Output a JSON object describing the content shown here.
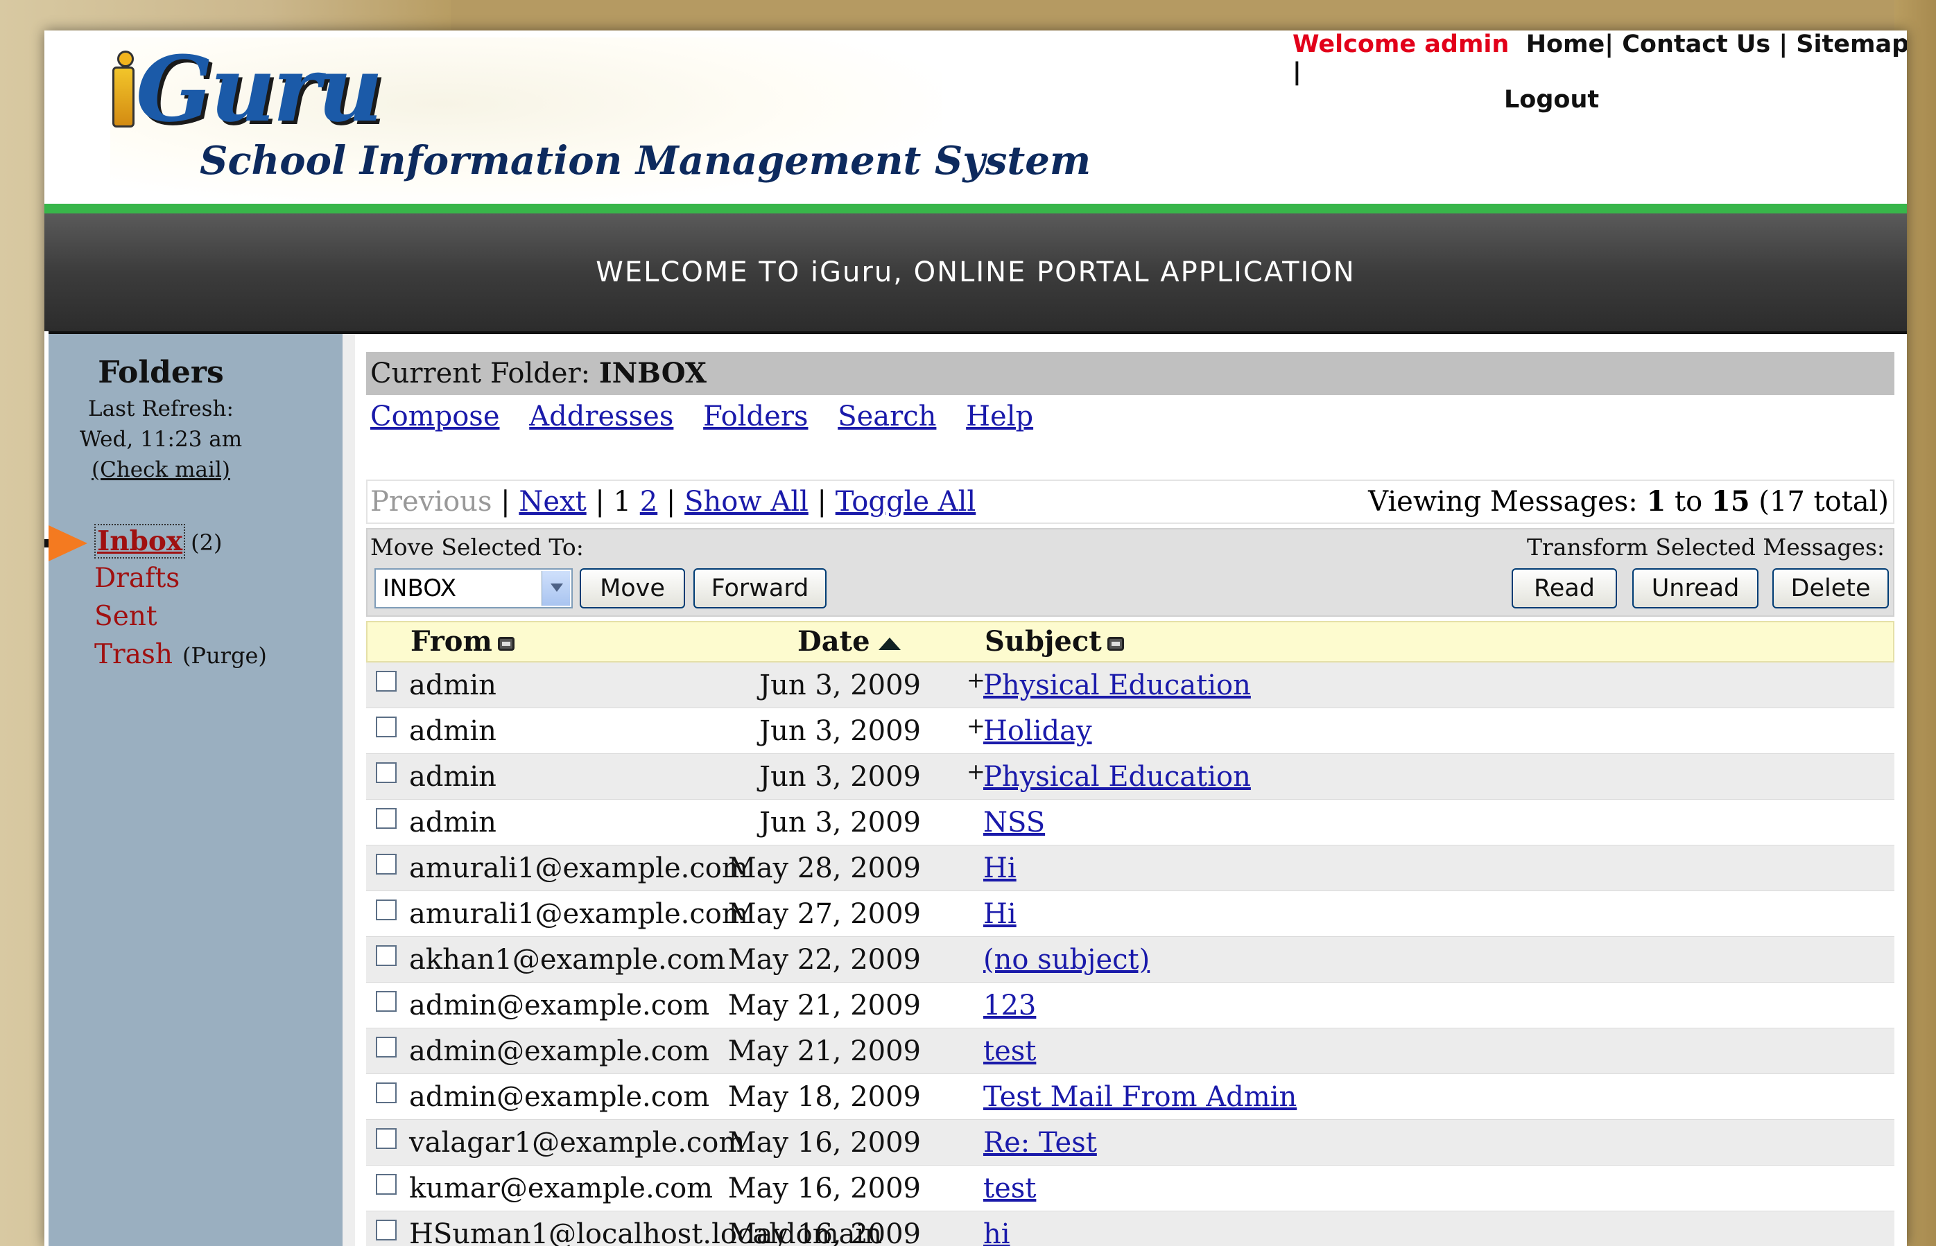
{
  "header": {
    "logo_text": "Guru",
    "tagline": "School Information Management System",
    "welcome": "Welcome admin",
    "links": [
      "Home|",
      "Contact Us |",
      "Sitemap |",
      "Logout"
    ],
    "banner": "WELCOME TO iGuru, ONLINE PORTAL APPLICATION"
  },
  "sidebar": {
    "title": "Folders",
    "last_refresh_label": "Last Refresh:",
    "last_refresh_time": "Wed, 11:23 am",
    "check_mail": "(Check mail)",
    "folders": [
      {
        "label": "Inbox",
        "count": "(2)"
      },
      {
        "label": "Drafts"
      },
      {
        "label": "Sent"
      },
      {
        "label": "Trash",
        "extra": "(Purge)"
      }
    ]
  },
  "main": {
    "current_folder_label": "Current Folder:",
    "current_folder": "INBOX",
    "toolbar": [
      "Compose",
      "Addresses",
      "Folders",
      "Search",
      "Help"
    ],
    "nav": {
      "previous": "Previous",
      "next": "Next",
      "page1": "1",
      "page2": "2",
      "show_all": "Show All",
      "toggle_all": "Toggle All"
    },
    "viewing": {
      "prefix": "Viewing Messages:",
      "from": "1",
      "to_word": "to",
      "to": "15",
      "total": "(17 total)"
    },
    "move_label": "Move Selected To:",
    "transform_label": "Transform Selected Messages:",
    "select_value": "INBOX",
    "buttons": {
      "move": "Move",
      "forward": "Forward",
      "read": "Read",
      "unread": "Unread",
      "delete": "Delete"
    },
    "columns": {
      "from": "From",
      "date": "Date",
      "subject": "Subject"
    },
    "messages": [
      {
        "from": "admin",
        "date": "Jun 3, 2009",
        "flag": "+",
        "subject": "Physical Education"
      },
      {
        "from": "admin",
        "date": "Jun 3, 2009",
        "flag": "+",
        "subject": "Holiday"
      },
      {
        "from": "admin",
        "date": "Jun 3, 2009",
        "flag": "+",
        "subject": "Physical Education"
      },
      {
        "from": "admin",
        "date": "Jun 3, 2009",
        "flag": "",
        "subject": "NSS"
      },
      {
        "from": "amurali1@example.com",
        "date": "May 28, 2009",
        "flag": "",
        "subject": "Hi"
      },
      {
        "from": "amurali1@example.com",
        "date": "May 27, 2009",
        "flag": "",
        "subject": "Hi"
      },
      {
        "from": "akhan1@example.com",
        "date": "May 22, 2009",
        "flag": "",
        "subject": "(no subject)"
      },
      {
        "from": "admin@example.com",
        "date": "May 21, 2009",
        "flag": "",
        "subject": "123"
      },
      {
        "from": "admin@example.com",
        "date": "May 21, 2009",
        "flag": "",
        "subject": "test"
      },
      {
        "from": "admin@example.com",
        "date": "May 18, 2009",
        "flag": "",
        "subject": "Test Mail From Admin"
      },
      {
        "from": "valagar1@example.com",
        "date": "May 16, 2009",
        "flag": "",
        "subject": "Re: Test"
      },
      {
        "from": "kumar@example.com",
        "date": "May 16, 2009",
        "flag": "",
        "subject": "test"
      },
      {
        "from": "HSuman1@localhost.localdomain",
        "date": "May 16, 2009",
        "flag": "",
        "subject": "hi"
      }
    ]
  }
}
